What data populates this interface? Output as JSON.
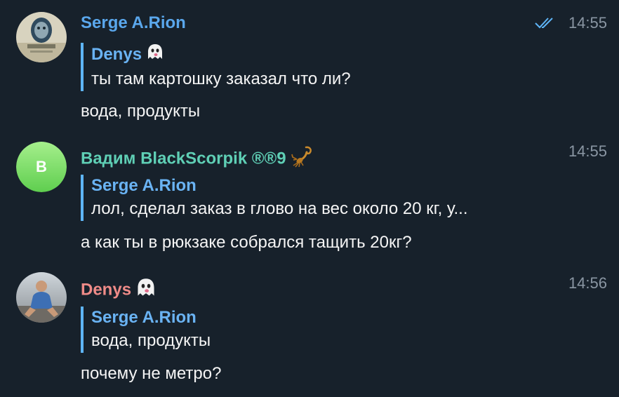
{
  "colors": {
    "background": "#17212b",
    "name_blue": "#5aa7ec",
    "name_teal": "#5fcfb5",
    "name_pink": "#ef8b88",
    "quote_bar": "#5eb5f7",
    "time": "#8a96a3"
  },
  "messages": [
    {
      "sender": "Serge A.Rion",
      "time": "14:55",
      "status_icon": "double-check-icon",
      "quote_author": "Denys",
      "quote_emoji_icon": "ghost-icon",
      "quote_text": "ты там картошку заказал что ли?",
      "text": "вода, продукты"
    },
    {
      "sender": "Вадим BlackScorpik ®®9",
      "sender_icon": "scorpion-icon",
      "avatar_initial": "B",
      "time": "14:55",
      "quote_author": "Serge A.Rion",
      "quote_text": "лол, сделал заказ в глово на вес около 20 кг, у...",
      "text": "а как ты в рюкзаке собрался тащить 20кг?"
    },
    {
      "sender": "Denys",
      "sender_icon": "ghost-icon",
      "time": "14:56",
      "quote_author": "Serge A.Rion",
      "quote_text": "вода, продукты",
      "text": "почему не метро?"
    }
  ]
}
